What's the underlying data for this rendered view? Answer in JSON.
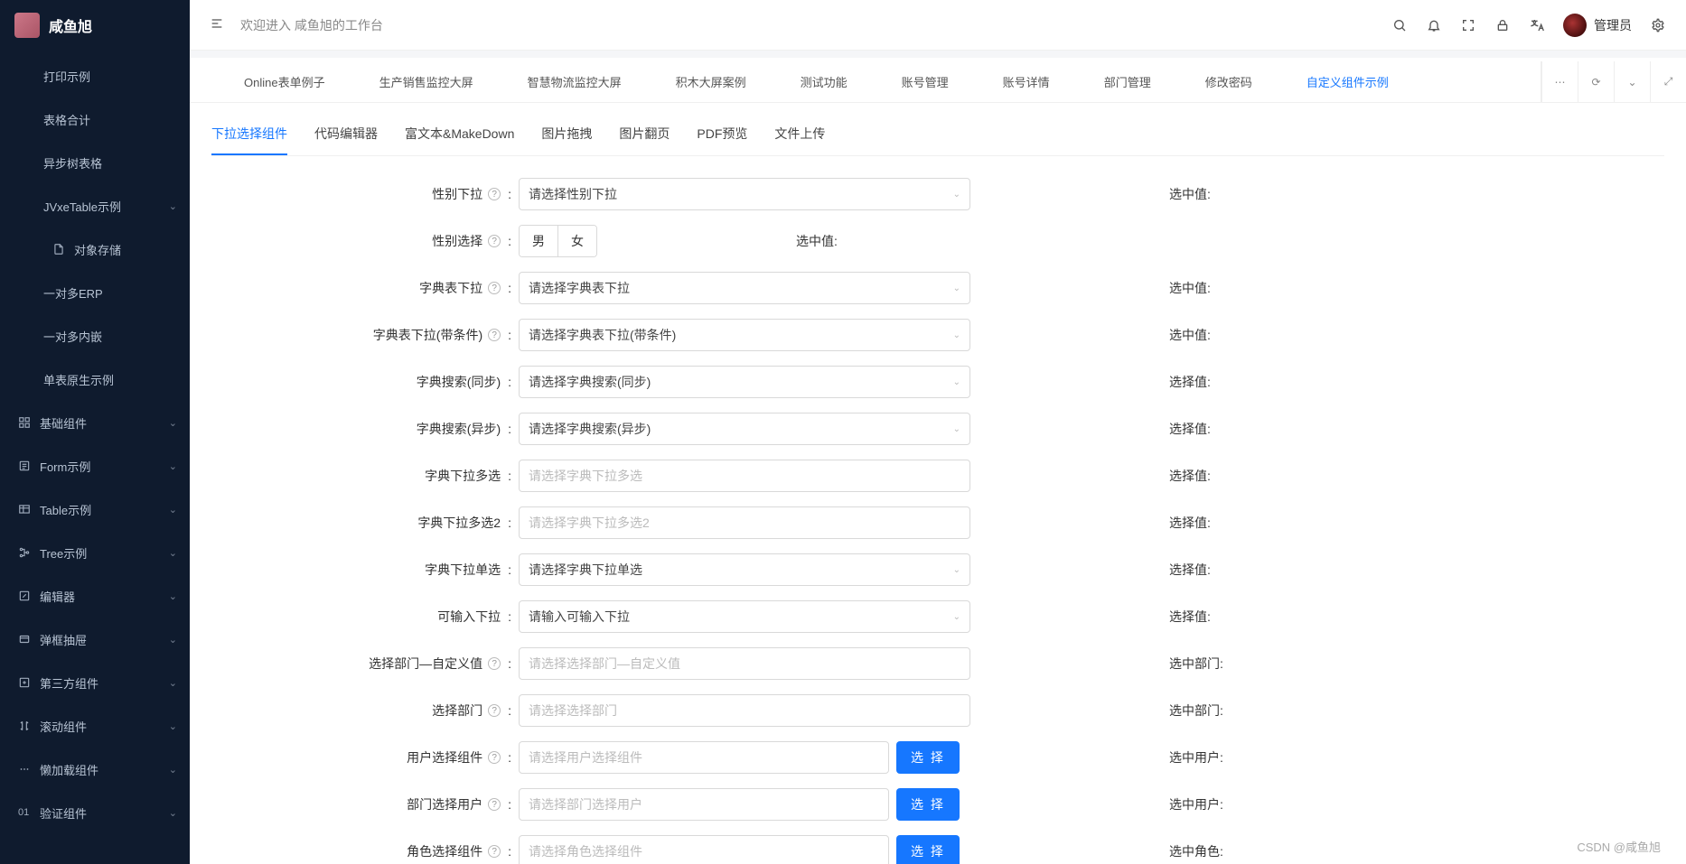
{
  "app_title": "咸鱼旭",
  "welcome": "欢迎进入 咸鱼旭的工作台",
  "user_name": "管理员",
  "watermark": "CSDN @咸鱼旭",
  "sidebar": {
    "items": [
      {
        "label": "打印示例",
        "chev": false,
        "group": false,
        "icon": ""
      },
      {
        "label": "表格合计",
        "chev": false,
        "group": false,
        "icon": ""
      },
      {
        "label": "异步树表格",
        "chev": false,
        "group": false,
        "icon": ""
      },
      {
        "label": "JVxeTable示例",
        "chev": true,
        "group": false,
        "icon": ""
      },
      {
        "label": "对象存储",
        "chev": false,
        "group": false,
        "icon": "file"
      },
      {
        "label": "一对多ERP",
        "chev": false,
        "group": false,
        "icon": ""
      },
      {
        "label": "一对多内嵌",
        "chev": false,
        "group": false,
        "icon": ""
      },
      {
        "label": "单表原生示例",
        "chev": false,
        "group": false,
        "icon": ""
      },
      {
        "label": "基础组件",
        "chev": true,
        "group": true,
        "icon": "grid"
      },
      {
        "label": "Form示例",
        "chev": true,
        "group": true,
        "icon": "form"
      },
      {
        "label": "Table示例",
        "chev": true,
        "group": true,
        "icon": "table"
      },
      {
        "label": "Tree示例",
        "chev": true,
        "group": true,
        "icon": "tree"
      },
      {
        "label": "编辑器",
        "chev": true,
        "group": true,
        "icon": "edit"
      },
      {
        "label": "弹框抽屉",
        "chev": true,
        "group": true,
        "icon": "modal"
      },
      {
        "label": "第三方组件",
        "chev": true,
        "group": true,
        "icon": "plus"
      },
      {
        "label": "滚动组件",
        "chev": true,
        "group": true,
        "icon": "scroll"
      },
      {
        "label": "懒加载组件",
        "chev": true,
        "group": true,
        "icon": "dots"
      },
      {
        "label": "验证组件",
        "chev": true,
        "group": true,
        "icon": "num",
        "num": "01"
      }
    ]
  },
  "tabs": [
    {
      "label": "Online表单例子"
    },
    {
      "label": "生产销售监控大屏"
    },
    {
      "label": "智慧物流监控大屏"
    },
    {
      "label": "积木大屏案例"
    },
    {
      "label": "测试功能"
    },
    {
      "label": "账号管理"
    },
    {
      "label": "账号详情"
    },
    {
      "label": "部门管理"
    },
    {
      "label": "修改密码"
    },
    {
      "label": "自定义组件示例",
      "active": true
    }
  ],
  "subtabs": [
    {
      "label": "下拉选择组件",
      "active": true
    },
    {
      "label": "代码编辑器"
    },
    {
      "label": "富文本&MakeDown"
    },
    {
      "label": "图片拖拽"
    },
    {
      "label": "图片翻页"
    },
    {
      "label": "PDF预览"
    },
    {
      "label": "文件上传"
    }
  ],
  "form": [
    {
      "label": "性别下拉",
      "help": true,
      "type": "select",
      "placeholder": "请选择性别下拉",
      "value_label": "选中值:"
    },
    {
      "label": "性别选择",
      "help": true,
      "type": "radio",
      "options": [
        "男",
        "女"
      ],
      "value_label": "选中值:"
    },
    {
      "label": "字典表下拉",
      "help": true,
      "type": "select",
      "placeholder": "请选择字典表下拉",
      "value_label": "选中值:"
    },
    {
      "label": "字典表下拉(带条件)",
      "help": true,
      "type": "select",
      "placeholder": "请选择字典表下拉(带条件)",
      "value_label": "选中值:"
    },
    {
      "label": "字典搜索(同步)",
      "help": false,
      "type": "select",
      "placeholder": "请选择字典搜索(同步)",
      "value_label": "选择值:"
    },
    {
      "label": "字典搜索(异步)",
      "help": false,
      "type": "select",
      "placeholder": "请选择字典搜索(异步)",
      "value_label": "选择值:"
    },
    {
      "label": "字典下拉多选",
      "help": false,
      "type": "input_ph",
      "placeholder": "请选择字典下拉多选",
      "value_label": "选择值:"
    },
    {
      "label": "字典下拉多选2",
      "help": false,
      "type": "input_ph",
      "placeholder": "请选择字典下拉多选2",
      "value_label": "选择值:"
    },
    {
      "label": "字典下拉单选",
      "help": false,
      "type": "select",
      "placeholder": "请选择字典下拉单选",
      "value_label": "选择值:"
    },
    {
      "label": "可输入下拉",
      "help": false,
      "type": "select",
      "placeholder": "请输入可输入下拉",
      "value_label": "选择值:"
    },
    {
      "label": "选择部门—自定义值",
      "help": true,
      "type": "input_ph",
      "placeholder": "请选择选择部门—自定义值",
      "value_label": "选中部门:"
    },
    {
      "label": "选择部门",
      "help": true,
      "type": "input_ph",
      "placeholder": "请选择选择部门",
      "value_label": "选中部门:"
    },
    {
      "label": "用户选择组件",
      "help": true,
      "type": "input_btn",
      "placeholder": "请选择用户选择组件",
      "btn": "选 择",
      "value_label": "选中用户:"
    },
    {
      "label": "部门选择用户",
      "help": true,
      "type": "input_btn",
      "placeholder": "请选择部门选择用户",
      "btn": "选 择",
      "value_label": "选中用户:"
    },
    {
      "label": "角色选择组件",
      "help": true,
      "type": "input_btn",
      "placeholder": "请选择角色选择组件",
      "btn": "选 择",
      "value_label": "选中角色:"
    }
  ]
}
